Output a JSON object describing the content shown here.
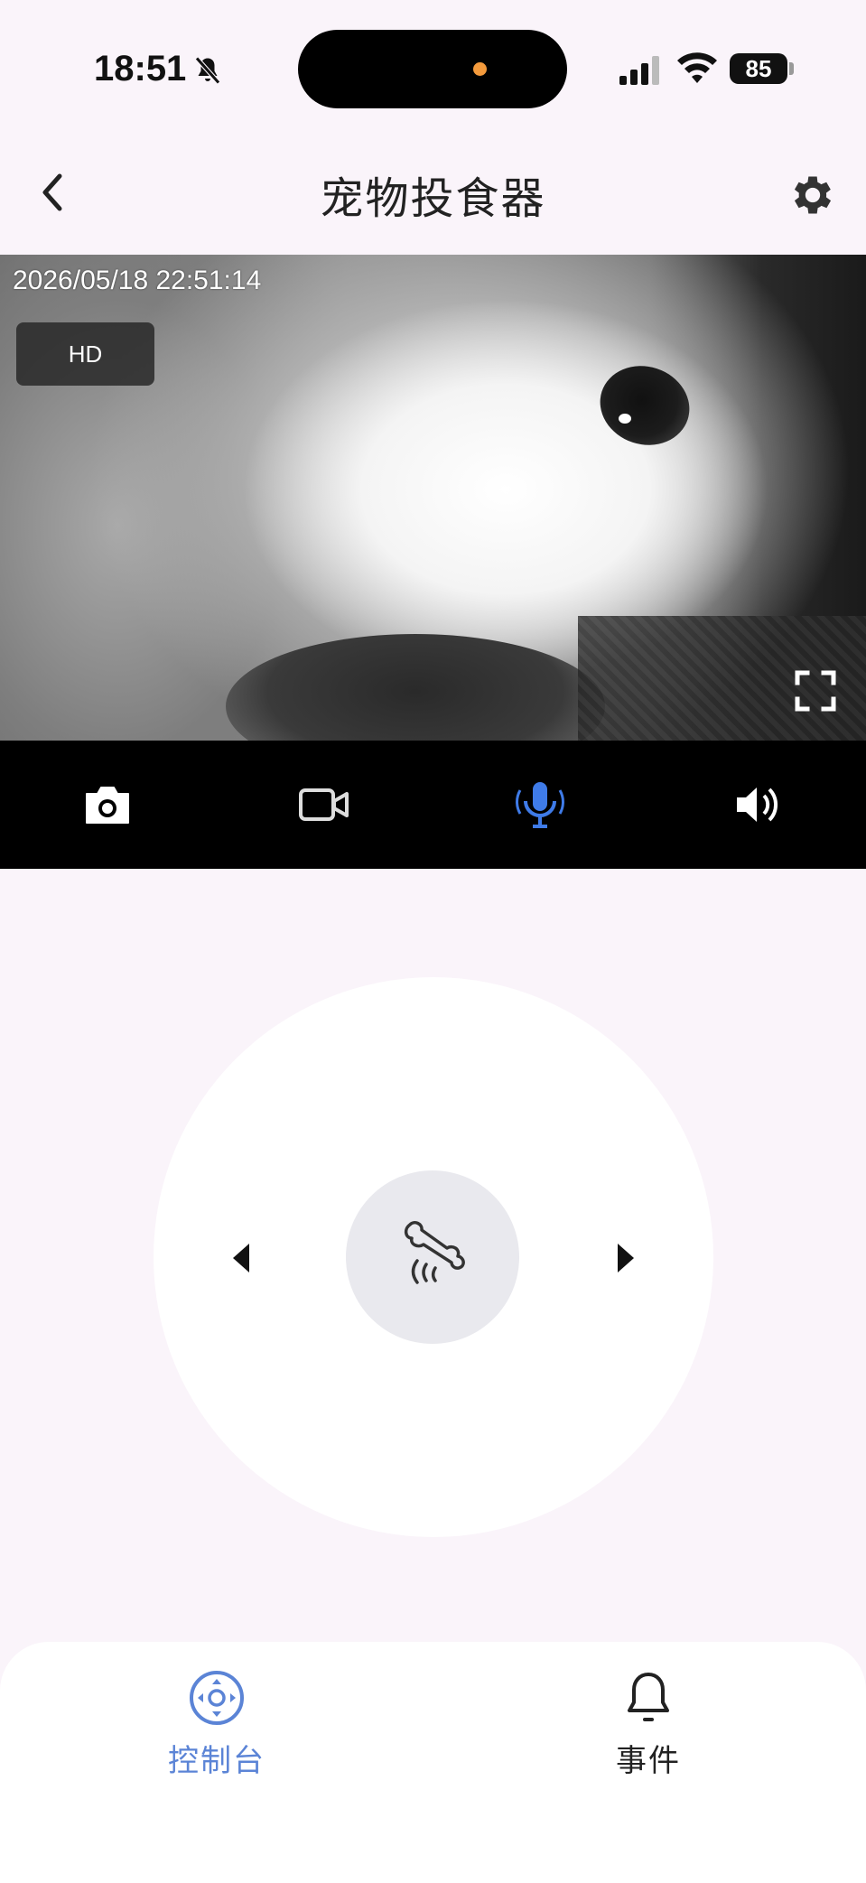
{
  "status_bar": {
    "time": "18:51",
    "battery": "85",
    "icons": [
      "bell-slash-icon",
      "cellular-signal-icon",
      "wifi-icon",
      "battery-icon"
    ]
  },
  "header": {
    "title": "宠物投食器",
    "back_icon": "chevron-left-icon",
    "settings_icon": "gear-icon"
  },
  "video": {
    "timestamp": "2026/05/18 22:51:14",
    "quality_label": "HD",
    "fullscreen_icon": "fullscreen-icon"
  },
  "controls": {
    "items": [
      "camera-icon",
      "video-record-icon",
      "microphone-icon",
      "speaker-icon"
    ],
    "active_color": "#3f7be8"
  },
  "feeder": {
    "feed_icon": "bone-icon",
    "left_icon": "triangle-left-icon",
    "right_icon": "triangle-right-icon"
  },
  "tabs": [
    {
      "label": "控制台",
      "icon": "dpad-icon",
      "active": true
    },
    {
      "label": "事件",
      "icon": "bell-icon",
      "active": false
    }
  ],
  "colors": {
    "accent": "#5b84d6",
    "background": "#faf4fa",
    "video_bar": "#000000"
  }
}
